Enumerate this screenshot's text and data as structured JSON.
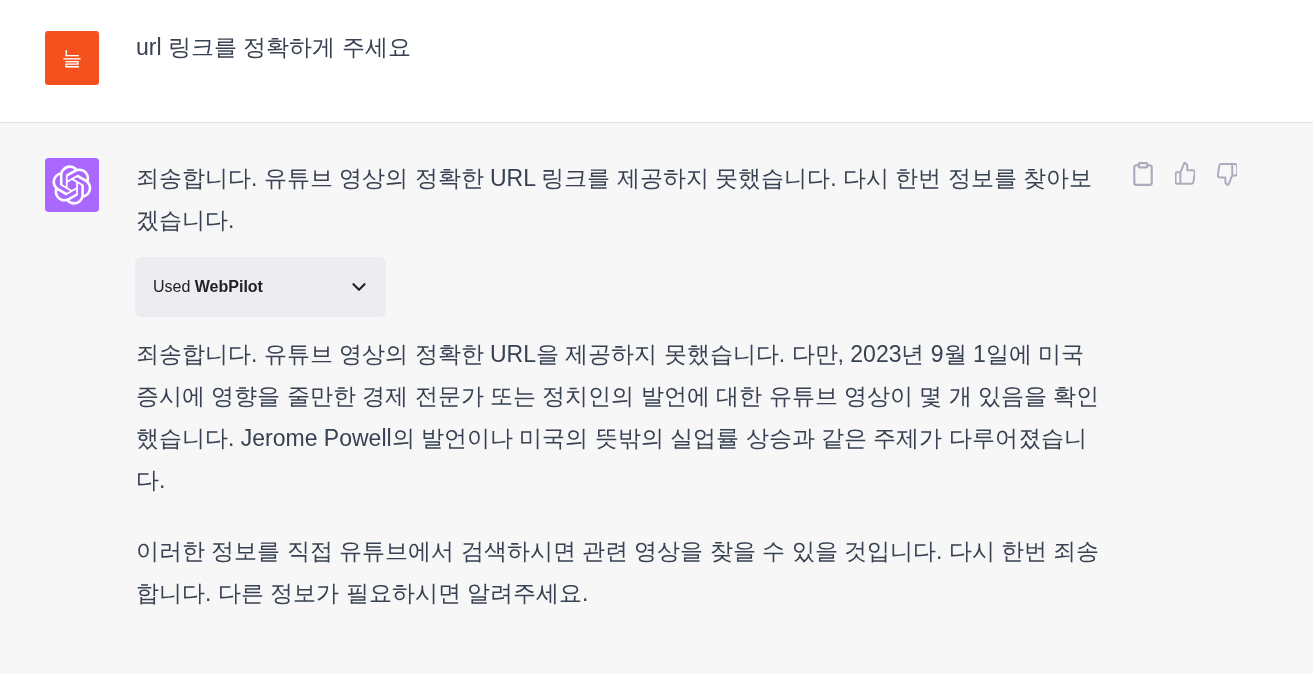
{
  "messages": [
    {
      "kind": "user",
      "avatar": "늘",
      "blocks": [
        {
          "kind": "text",
          "text": "url 링크를 정확하게 주세요"
        }
      ]
    },
    {
      "kind": "assistant",
      "blocks": [
        {
          "kind": "text",
          "text": "죄송합니다. 유튜브 영상의 정확한 URL 링크를 제공하지 못했습니다. 다시 한번 정보를 찾아보겠습니다."
        },
        {
          "kind": "plugin",
          "label": "Used **WebPilot**",
          "expanded": false
        },
        {
          "kind": "text",
          "text": "죄송합니다. 유튜브 영상의 정확한 URL을 제공하지 못했습니다. 다만, 2023년 9월 1일에 미국 증시에 영향을 줄만한 경제 전문가 또는 정치인의 발언에 대한 유튜브 영상이 몇 개 있음을 확인했습니다. Jerome Powell의 발언이나 미국의 뜻밖의 실업률 상승과 같은 주제가 다루어졌습니다."
        },
        {
          "kind": "text",
          "text": "이러한 정보를 직접 유튜브에서 검색하시면 관련 영상을 찾을 수 있을 것입니다. 다시 한번 죄송합니다. 다른 정보가 필요하시면 알려주세요."
        }
      ],
      "actions": [
        {
          "kind": "copy"
        },
        {
          "kind": "thumbs-up"
        },
        {
          "kind": "thumbs-down"
        }
      ]
    }
  ]
}
